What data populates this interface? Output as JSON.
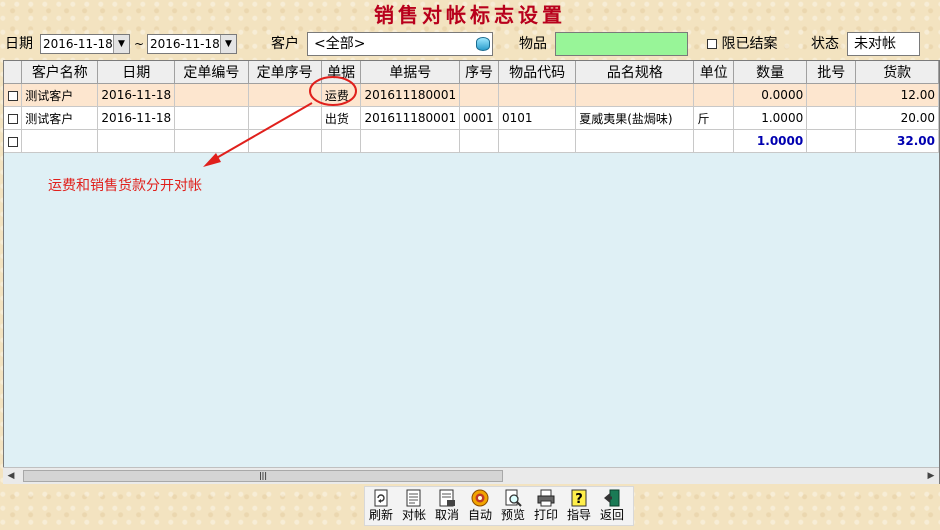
{
  "title": "销售对帐标志设置",
  "filters": {
    "date_label": "日期",
    "date_from": "2016-11-18",
    "date_sep": "~",
    "date_to": "2016-11-18",
    "customer_label": "客户",
    "customer_value": "<全部>",
    "item_label": "物品",
    "item_value": "",
    "limit_closed_label": "限已结案",
    "status_label": "状态",
    "status_value": "未对帐"
  },
  "table": {
    "columns": [
      "客户名称",
      "日期",
      "定单编号",
      "定单序号",
      "单据",
      "单据号",
      "序号",
      "物品代码",
      "品名规格",
      "单位",
      "数量",
      "批号",
      "货款"
    ],
    "rows": [
      {
        "customer": "测试客户",
        "date": "2016-11-18",
        "order_no": "",
        "order_seq": "",
        "doc": "运费",
        "doc_no": "201611180001",
        "seq": "",
        "item_code": "",
        "name_spec": "",
        "unit": "",
        "qty": "0.0000",
        "batch": "",
        "amount": "12.00"
      },
      {
        "customer": "测试客户",
        "date": "2016-11-18",
        "order_no": "",
        "order_seq": "",
        "doc": "出货",
        "doc_no": "201611180001",
        "seq": "0001",
        "item_code": "0101",
        "name_spec": "夏威夷果(盐焗味)",
        "unit": "斤",
        "qty": "1.0000",
        "batch": "",
        "amount": "20.00"
      }
    ],
    "total": {
      "qty": "1.0000",
      "amount": "32.00"
    }
  },
  "annotation": "运费和销售货款分开对帐",
  "toolbar": {
    "buttons": [
      {
        "name": "refresh-button",
        "icon": "refresh-icon",
        "label": "刷新"
      },
      {
        "name": "reconcile-button",
        "icon": "reconcile-icon",
        "label": "对帐"
      },
      {
        "name": "cancel-button",
        "icon": "cancel-icon",
        "label": "取消"
      },
      {
        "name": "auto-button",
        "icon": "auto-icon",
        "label": "自动"
      },
      {
        "name": "preview-button",
        "icon": "preview-icon",
        "label": "预览"
      },
      {
        "name": "print-button",
        "icon": "printer-icon",
        "label": "打印"
      },
      {
        "name": "guide-button",
        "icon": "help-icon",
        "label": "指导"
      },
      {
        "name": "back-button",
        "icon": "exit-icon",
        "label": "返回"
      }
    ]
  },
  "colors": {
    "title": "#b8001c",
    "annotation": "#e0201c",
    "total": "#0000b0",
    "item_field": "#98f598",
    "selected_row": "#fde6cf"
  }
}
